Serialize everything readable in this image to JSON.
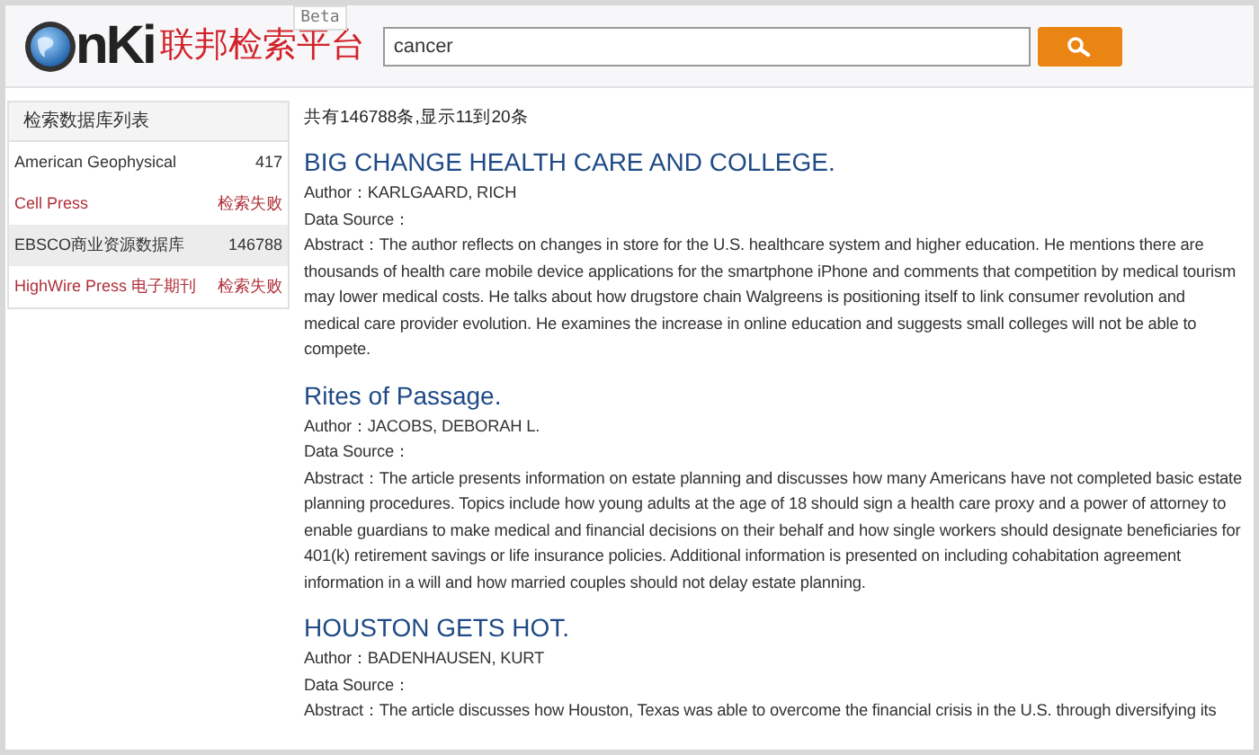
{
  "header": {
    "logo_letters": "nKi",
    "logo_name": "联邦检索平台",
    "beta": "Beta",
    "search": {
      "value": "cancer"
    }
  },
  "sidebar": {
    "title": "检索数据库列表",
    "items": [
      {
        "name": "American Geophysical",
        "count": "417",
        "kind": "ok",
        "selected": false
      },
      {
        "name": "Cell Press",
        "count": "检索失败",
        "kind": "failed",
        "selected": false
      },
      {
        "name": "EBSCO商业资源数据库",
        "count": "146788",
        "kind": "ok",
        "selected": true
      },
      {
        "name": "HighWire Press 电子期刊",
        "count": "检索失败",
        "kind": "failed",
        "selected": false
      }
    ]
  },
  "summary": "共有146788条,显示11到20条",
  "results": [
    {
      "title": "BIG CHANGE HEALTH CARE AND COLLEGE.",
      "author_label": "Author：",
      "author": "KARLGAARD, RICH",
      "source_label": "Data Source：",
      "abstract_label": "Abstract：",
      "abstract": "The author reflects on changes in store for the U.S. healthcare system and higher education. He mentions there are thousands of health care mobile device applications for the smartphone iPhone and comments that competition by medical tourism may lower medical costs. He talks about how drugstore chain Walgreens is positioning itself to link consumer revolution and medical care provider evolution. He examines the increase in online education and suggests small colleges will not be able to compete."
    },
    {
      "title": "Rites of Passage.",
      "author_label": "Author：",
      "author": "JACOBS, DEBORAH L.",
      "source_label": "Data Source：",
      "abstract_label": "Abstract：",
      "abstract": "The article presents information on estate planning and discusses how many Americans have not completed basic estate planning procedures. Topics include how young adults at the age of 18 should sign a health care proxy and a power of attorney to enable guardians to make medical and financial decisions on their behalf and how single workers should designate beneficiaries for 401(k) retirement savings or life insurance policies. Additional information is presented on including cohabitation agreement information in a will and how married couples should not delay estate planning."
    },
    {
      "title": "HOUSTON GETS HOT.",
      "author_label": "Author：",
      "author": "BADENHAUSEN, KURT",
      "source_label": "Data Source：",
      "abstract_label": "Abstract：",
      "abstract": "The article discusses how Houston, Texas was able to overcome the financial crisis in the U.S. through diversifying its"
    }
  ]
}
